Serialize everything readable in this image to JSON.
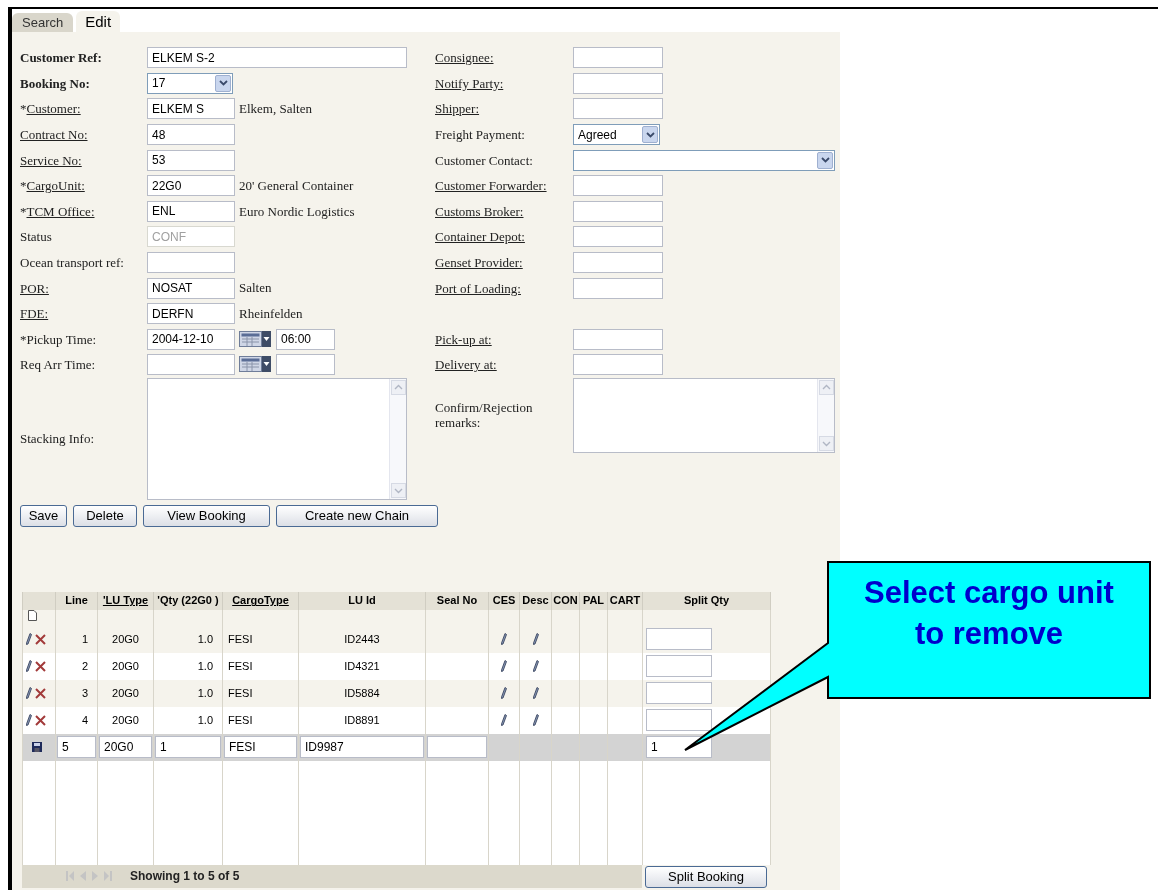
{
  "tabs": [
    {
      "label": "Search",
      "selected": false
    },
    {
      "label": "Edit",
      "selected": true
    }
  ],
  "rows": [
    {
      "left": {
        "label": "Customer Ref:",
        "bold": true,
        "link": false,
        "kind": "wide_text",
        "value": "ELKEM S-2"
      },
      "right": {
        "label": "Consignee:",
        "bold": false,
        "link": true,
        "kind": "text"
      }
    },
    {
      "left": {
        "label": "Booking No:",
        "bold": true,
        "link": false,
        "kind": "select",
        "value": "17"
      },
      "right": {
        "label": "Notify Party:",
        "bold": false,
        "link": true,
        "kind": "text"
      }
    },
    {
      "left": {
        "prefix": "*",
        "label": "Customer:",
        "bold": false,
        "link": true,
        "kind": "text",
        "value": "ELKEM S",
        "note": "Elkem, Salten"
      },
      "right": {
        "label": "Shipper:",
        "bold": false,
        "link": true,
        "kind": "text"
      }
    },
    {
      "left": {
        "label": "Contract No:",
        "bold": false,
        "link": true,
        "kind": "text",
        "value": "48"
      },
      "right": {
        "label": "Freight Payment:",
        "bold": false,
        "link": false,
        "kind": "select",
        "value": "Agreed"
      }
    },
    {
      "left": {
        "label": "Service No:",
        "bold": false,
        "link": true,
        "kind": "text",
        "value": "53"
      },
      "right": {
        "label": "Customer Contact:",
        "bold": false,
        "link": false,
        "kind": "wide_select"
      }
    },
    {
      "left": {
        "prefix": "*",
        "label": "CargoUnit:",
        "bold": false,
        "link": true,
        "kind": "text",
        "value": "22G0",
        "note": "20' General Container"
      },
      "right": {
        "label": "Customer Forwarder:",
        "bold": false,
        "link": true,
        "kind": "text"
      }
    },
    {
      "left": {
        "prefix": "*",
        "label": "TCM Office:",
        "bold": false,
        "link": true,
        "kind": "text",
        "value": "ENL",
        "note": "Euro Nordic Logistics"
      },
      "right": {
        "label": "Customs Broker:",
        "bold": false,
        "link": true,
        "kind": "text"
      }
    },
    {
      "left": {
        "label": "Status",
        "bold": false,
        "link": false,
        "kind": "disabled_text",
        "value": "CONF"
      },
      "right": {
        "label": "Container Depot:",
        "bold": false,
        "link": true,
        "kind": "text"
      }
    },
    {
      "left": {
        "label": "Ocean transport ref:",
        "bold": false,
        "link": false,
        "kind": "text"
      },
      "right": {
        "label": "Genset Provider:",
        "bold": false,
        "link": true,
        "kind": "text"
      }
    },
    {
      "left": {
        "label": "POR:",
        "bold": false,
        "link": true,
        "kind": "text",
        "value": "NOSAT",
        "note": "Salten"
      },
      "right": {
        "label": "Port of Loading:",
        "bold": false,
        "link": true,
        "kind": "text"
      }
    },
    {
      "left": {
        "label": "FDE:",
        "bold": false,
        "link": true,
        "kind": "text",
        "value": "DERFN",
        "note": "Rheinfelden"
      }
    },
    {
      "left": {
        "prefix": "*",
        "label": "Pickup Time:",
        "bold": false,
        "link": false,
        "kind": "datetime",
        "value": "2004-12-10",
        "time": "06:00"
      },
      "right": {
        "label": "Pick-up at:",
        "bold": false,
        "link": true,
        "kind": "text"
      }
    },
    {
      "left": {
        "label": "Req Arr Time:",
        "bold": false,
        "link": false,
        "kind": "datetime"
      },
      "right": {
        "label": "Delivery at:",
        "bold": false,
        "link": true,
        "kind": "text"
      }
    },
    {
      "left": {
        "label": "Stacking Info:",
        "bold": false,
        "link": false,
        "kind": "textarea_tall"
      },
      "right": {
        "label": "Confirm/Rejection remarks:",
        "bold": false,
        "link": false,
        "kind": "textarea"
      }
    }
  ],
  "buttons": [
    "Save",
    "Delete",
    "View Booking",
    "Create new Chain"
  ],
  "table": {
    "columns": [
      {
        "label": "Line",
        "kind": "data",
        "link": false
      },
      {
        "label": "'LU Type",
        "kind": "data",
        "link": true
      },
      {
        "label": "'Qty (22G0 )",
        "kind": "data",
        "link": false
      },
      {
        "label": "CargoType",
        "kind": "data",
        "link": true
      },
      {
        "label": "LU Id",
        "kind": "data",
        "link": false
      },
      {
        "label": "Seal No",
        "kind": "seal",
        "link": false
      },
      {
        "label": "CES",
        "kind": "edit_icon",
        "link": false
      },
      {
        "label": "Desc",
        "kind": "edit_icon",
        "link": false
      },
      {
        "label": "CON",
        "kind": "flag",
        "link": false
      },
      {
        "label": "PAL",
        "kind": "flag",
        "link": false
      },
      {
        "label": "CART",
        "kind": "flag",
        "link": false
      },
      {
        "label": "Split Qty",
        "kind": "split",
        "link": false
      }
    ],
    "rows": [
      {
        "kind": "view",
        "cells": [
          "1",
          "20G0",
          "1.0",
          "FESI",
          "ID2443"
        ]
      },
      {
        "kind": "view",
        "cells": [
          "2",
          "20G0",
          "1.0",
          "FESI",
          "ID4321"
        ]
      },
      {
        "kind": "view",
        "cells": [
          "3",
          "20G0",
          "1.0",
          "FESI",
          "ID5884"
        ]
      },
      {
        "kind": "view",
        "cells": [
          "4",
          "20G0",
          "1.0",
          "FESI",
          "ID8891"
        ]
      },
      {
        "kind": "edit",
        "cells": [
          "5",
          "20G0",
          "1",
          "FESI",
          "ID9987"
        ],
        "split_qty": "1"
      }
    ],
    "pager_text": "Showing 1 to 5 of 5",
    "footer_button": "Split Booking"
  },
  "callout": {
    "text": "Select cargo unit to remove"
  }
}
